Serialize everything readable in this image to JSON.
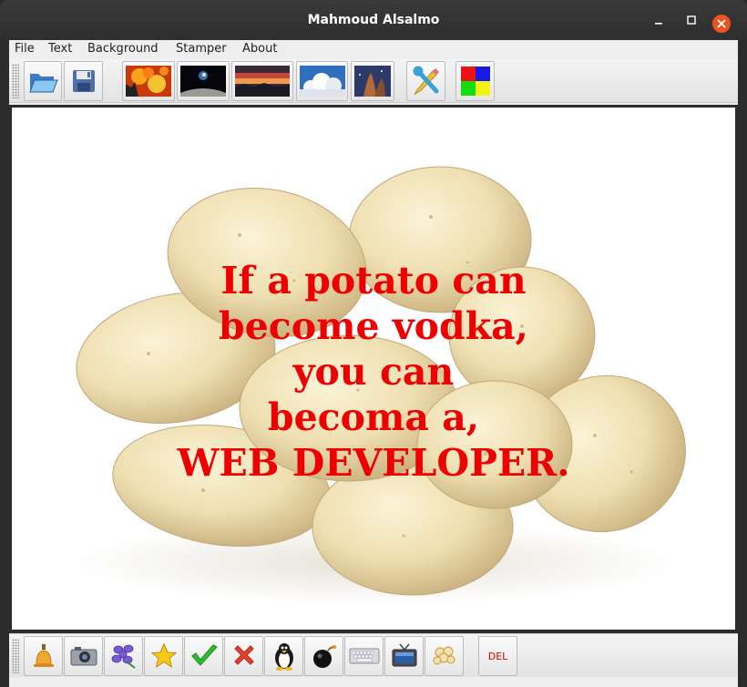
{
  "window": {
    "title": "Mahmoud Alsalmo",
    "accent": "#e95420"
  },
  "menu": {
    "items": [
      "File",
      "Text",
      "Background",
      "Stamper",
      "About"
    ]
  },
  "toolbar": {
    "buttons": [
      "open-folder-icon",
      "save-disk-icon",
      "background-fire-icon",
      "background-earthrise-icon",
      "background-sunset-icon",
      "background-clouds-icon",
      "background-nebula-icon",
      "edit-tools-icon",
      "color-palette-icon"
    ]
  },
  "canvas": {
    "background": "potatoes",
    "text_color": "#ee0000",
    "lines": [
      "If a potato can",
      "become vodka,",
      "you can",
      "becoma a,",
      "WEB DEVELOPER."
    ]
  },
  "stamps": {
    "buttons": [
      "bell-icon",
      "camera-icon",
      "flower-icon",
      "star-icon",
      "checkmark-icon",
      "x-mark-icon",
      "penguin-icon",
      "bomb-icon",
      "keyboard-icon",
      "tv-icon",
      "popcorn-icon"
    ],
    "del_label": "DEL"
  }
}
